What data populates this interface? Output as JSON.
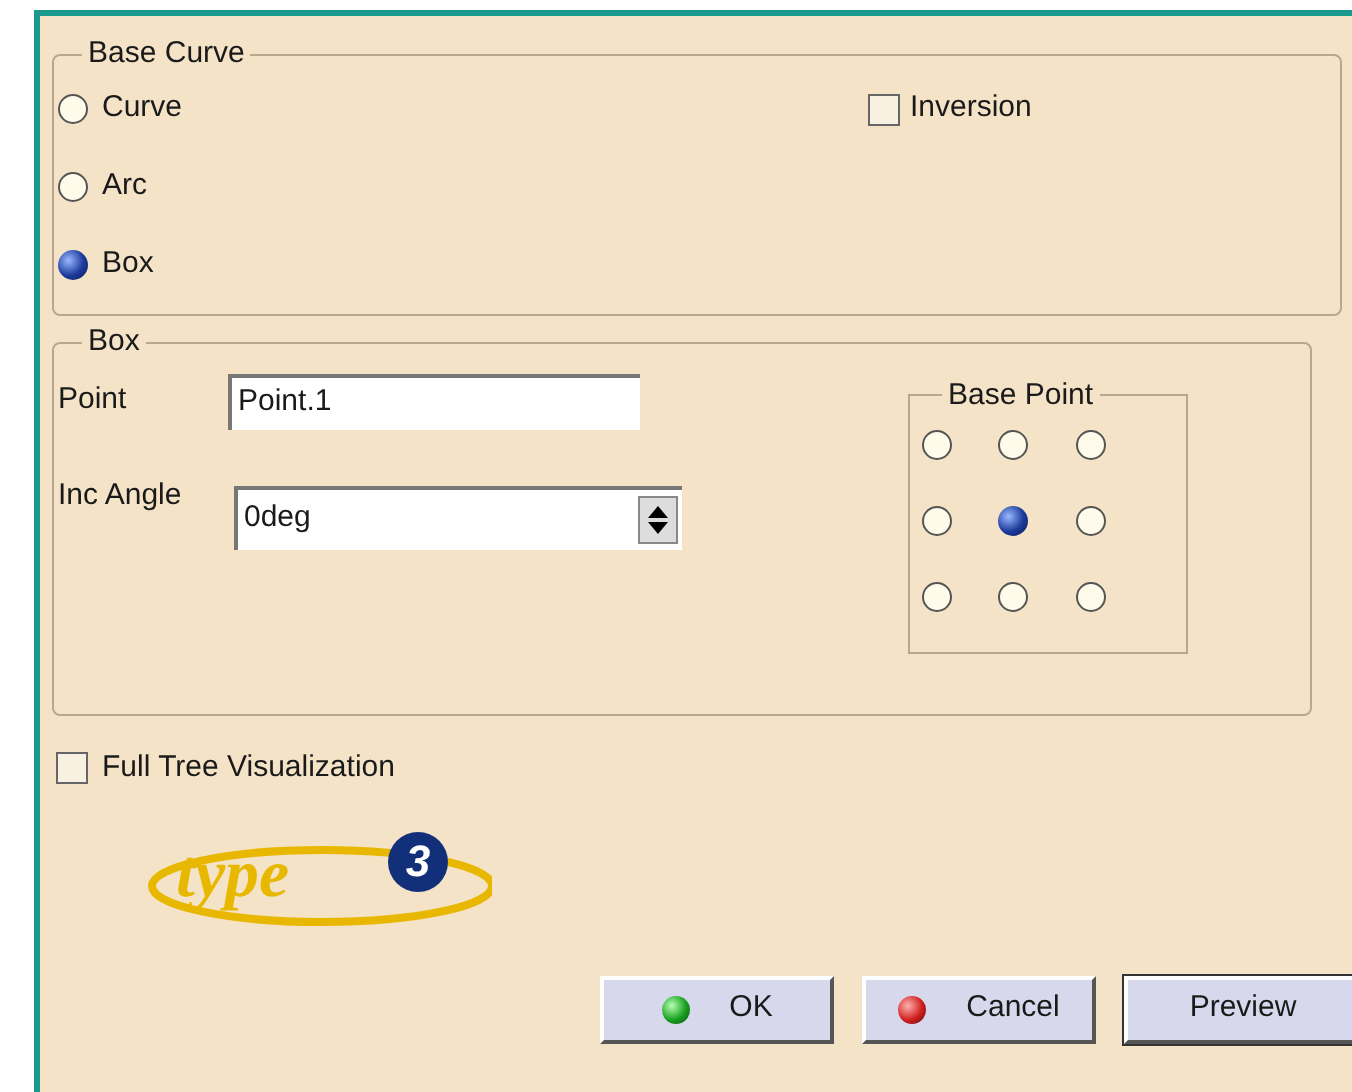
{
  "base_curve": {
    "title": "Base Curve",
    "options": [
      {
        "label": "Curve",
        "selected": false
      },
      {
        "label": "Arc",
        "selected": false
      },
      {
        "label": "Box",
        "selected": true
      }
    ],
    "inversion": {
      "label": "Inversion",
      "checked": false
    }
  },
  "box": {
    "title": "Box",
    "point": {
      "label": "Point",
      "value": "Point.1"
    },
    "inc_angle": {
      "label": "Inc Angle",
      "value": "0deg"
    },
    "base_point": {
      "title": "Base Point",
      "options": [
        {
          "selected": false
        },
        {
          "selected": false
        },
        {
          "selected": false
        },
        {
          "selected": false
        },
        {
          "selected": true
        },
        {
          "selected": false
        },
        {
          "selected": false
        },
        {
          "selected": false
        },
        {
          "selected": false
        }
      ]
    }
  },
  "full_tree": {
    "label": "Full Tree Visualization",
    "checked": false
  },
  "logo": {
    "word": "type",
    "digit": "3"
  },
  "buttons": [
    {
      "label": "OK",
      "kind": "ok"
    },
    {
      "label": "Cancel",
      "kind": "cancel"
    },
    {
      "label": "Preview",
      "kind": "plain"
    }
  ]
}
